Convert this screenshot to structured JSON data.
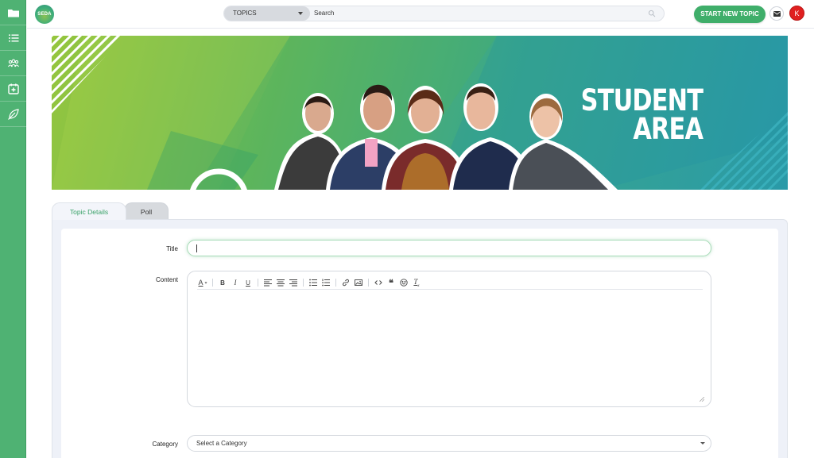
{
  "brand": {
    "logo_text": "SEDA",
    "accent": "#4fb273",
    "avatar_color": "#e02020"
  },
  "sidebar": {
    "items": [
      {
        "icon": "folder-icon"
      },
      {
        "icon": "list-icon"
      },
      {
        "icon": "people-icon"
      },
      {
        "icon": "calendar-icon"
      },
      {
        "icon": "leaf-icon"
      }
    ]
  },
  "topbar": {
    "search_scope": "TOPICS",
    "search_placeholder": "Search",
    "start_button": "START NEW TOPIC",
    "avatar_initial": "K"
  },
  "banner": {
    "title_line1": "STUDENT",
    "title_line2": "AREA"
  },
  "tabs": [
    {
      "label": "Topic Details",
      "active": true
    },
    {
      "label": "Poll",
      "active": false
    }
  ],
  "form": {
    "title_label": "Title",
    "title_value": "",
    "content_label": "Content",
    "category_label": "Category",
    "category_placeholder": "Select a Category"
  },
  "editor_toolbar": [
    "text-color",
    "bold",
    "italic",
    "underline",
    "align-left",
    "align-center",
    "align-right",
    "bullet-list",
    "numbered-list",
    "link",
    "image",
    "code",
    "quote",
    "emoji",
    "clear-format"
  ]
}
